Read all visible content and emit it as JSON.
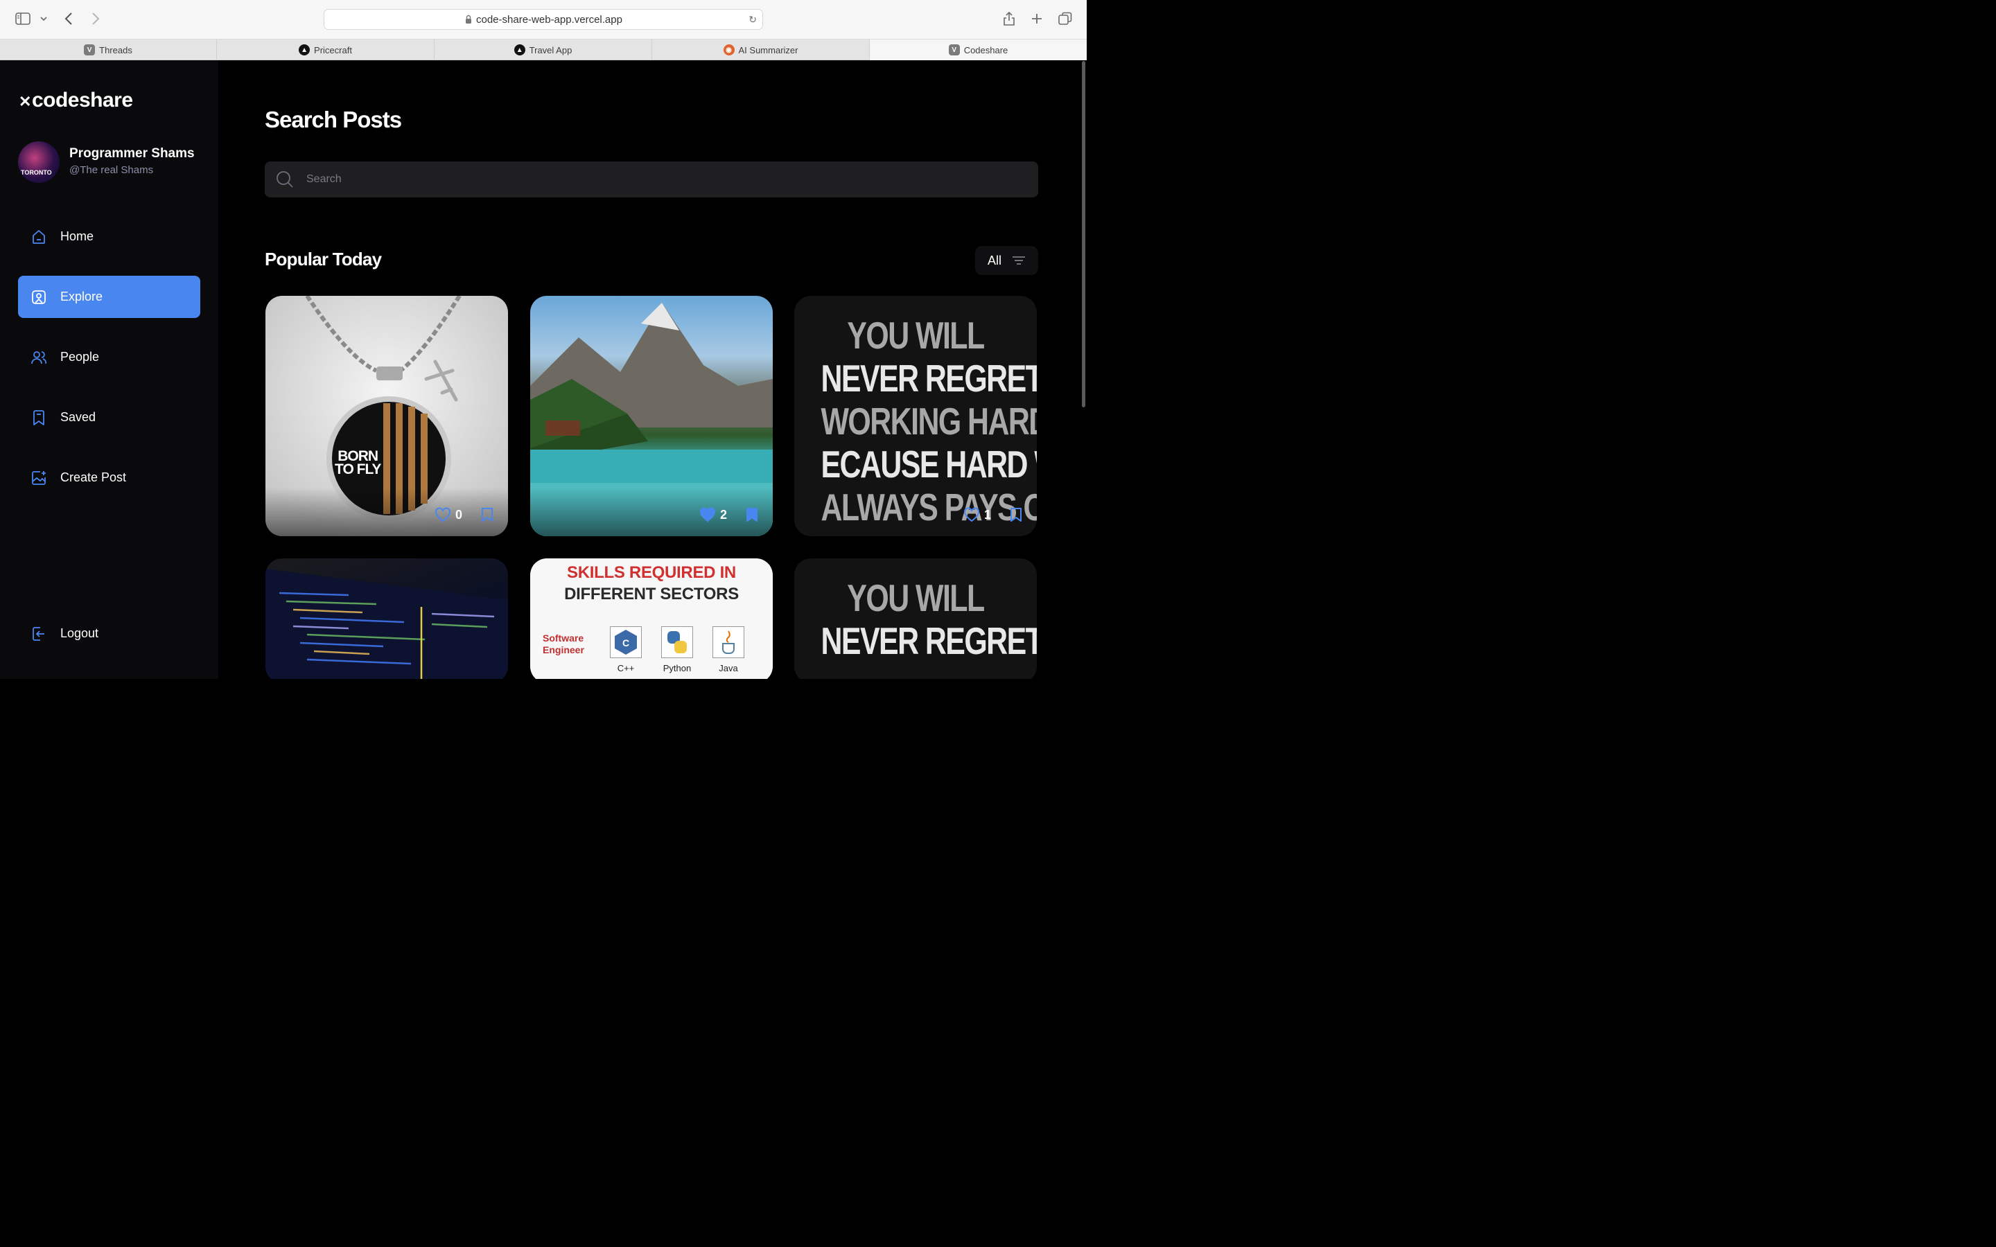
{
  "browser": {
    "url": "code-share-web-app.vercel.app",
    "tabs": [
      {
        "label": "Threads",
        "icon": "v-favicon"
      },
      {
        "label": "Pricecraft",
        "icon": "triangle-favicon"
      },
      {
        "label": "Travel App",
        "icon": "triangle-favicon"
      },
      {
        "label": "AI Summarizer",
        "icon": "ubuntu-favicon"
      },
      {
        "label": "Codeshare",
        "icon": "v-favicon",
        "active": true
      }
    ]
  },
  "sidebar": {
    "logo": "codeshare",
    "user": {
      "name": "Programmer Shams",
      "handle": "@The real Shams",
      "avatar_text": "TORONTO"
    },
    "nav": [
      {
        "label": "Home",
        "icon": "home-icon"
      },
      {
        "label": "Explore",
        "icon": "explore-icon",
        "active": true
      },
      {
        "label": "People",
        "icon": "people-icon"
      },
      {
        "label": "Saved",
        "icon": "bookmark-icon"
      },
      {
        "label": "Create Post",
        "icon": "image-add-icon"
      }
    ],
    "logout": "Logout"
  },
  "main": {
    "title": "Search Posts",
    "search": {
      "placeholder": "Search"
    },
    "section_title": "Popular Today",
    "filter_label": "All",
    "posts": [
      {
        "likes": "0",
        "liked": false,
        "saved": false,
        "image_text": [
          "BORN",
          "TO FLY"
        ]
      },
      {
        "likes": "2",
        "liked": true,
        "saved": true
      },
      {
        "likes": "1",
        "liked": false,
        "saved": false,
        "image_text": [
          "YOU WILL",
          "NEVER REGRET",
          "WORKING HARD",
          "ECAUSE HARD WOR",
          "ALWAYS PAYS OFF"
        ]
      },
      {},
      {
        "image_text": [
          "SKILLS REQUIRED IN",
          "DIFFERENT SECTORS",
          "Software",
          "Engineer",
          "C++",
          "Python",
          "Java"
        ]
      },
      {
        "image_text": [
          "YOU WILL",
          "NEVER REGRET"
        ]
      }
    ]
  },
  "colors": {
    "accent": "#4a86f0",
    "sidebar_bg": "#0a0a0d",
    "main_bg": "#000000"
  }
}
